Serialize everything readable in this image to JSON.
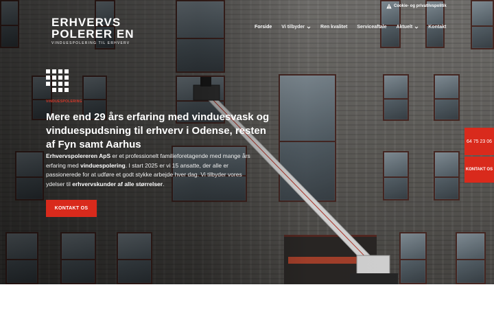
{
  "brand": {
    "name_line1": "ERHVERVS",
    "name_line2": "POLERER EN",
    "tagline": "VINDUESPOLERING TIL ERHVERV"
  },
  "topbar": {
    "cookie_icon": "warning-icon",
    "cookie_link": "Cookie- og privatlivspolitik"
  },
  "nav": {
    "items": [
      {
        "label": "Forside",
        "active": true,
        "has_dropdown": false
      },
      {
        "label": "Vi tilbyder",
        "active": false,
        "has_dropdown": true
      },
      {
        "label": "Ren kvalitet",
        "active": false,
        "has_dropdown": false
      },
      {
        "label": "Serviceaftale",
        "active": false,
        "has_dropdown": false
      },
      {
        "label": "Aktuelt",
        "active": false,
        "has_dropdown": true
      },
      {
        "label": "Kontakt",
        "active": false,
        "has_dropdown": false
      }
    ]
  },
  "hero": {
    "eyebrow": "VINDUESPOLERING",
    "headline": "Mere end 29 års erfaring med vinduesvask og vinduespudsning til erhverv i Odense, resten af Fyn samt Aarhus",
    "body_company": "Erhvervspolereren ApS",
    "body_part1": " er et professionelt familieforetagende med mange års erfaring med ",
    "body_keyword1": "vinduespolering",
    "body_part2": ". I start 2025 er vi 15 ansatte, der alle er passionerede for at udføre et godt stykke arbejde hver dag. Vi tilbyder vores ydelser til ",
    "body_keyword2": "erhvervskunder af alle størrelser",
    "body_part3": ".",
    "cta_label": "KONTAKT OS"
  },
  "side": {
    "phone": "64 75 23 06",
    "contact_label": "KONTAKT OS"
  },
  "colors": {
    "accent": "#d92a1c",
    "text_light": "#ffffff"
  }
}
